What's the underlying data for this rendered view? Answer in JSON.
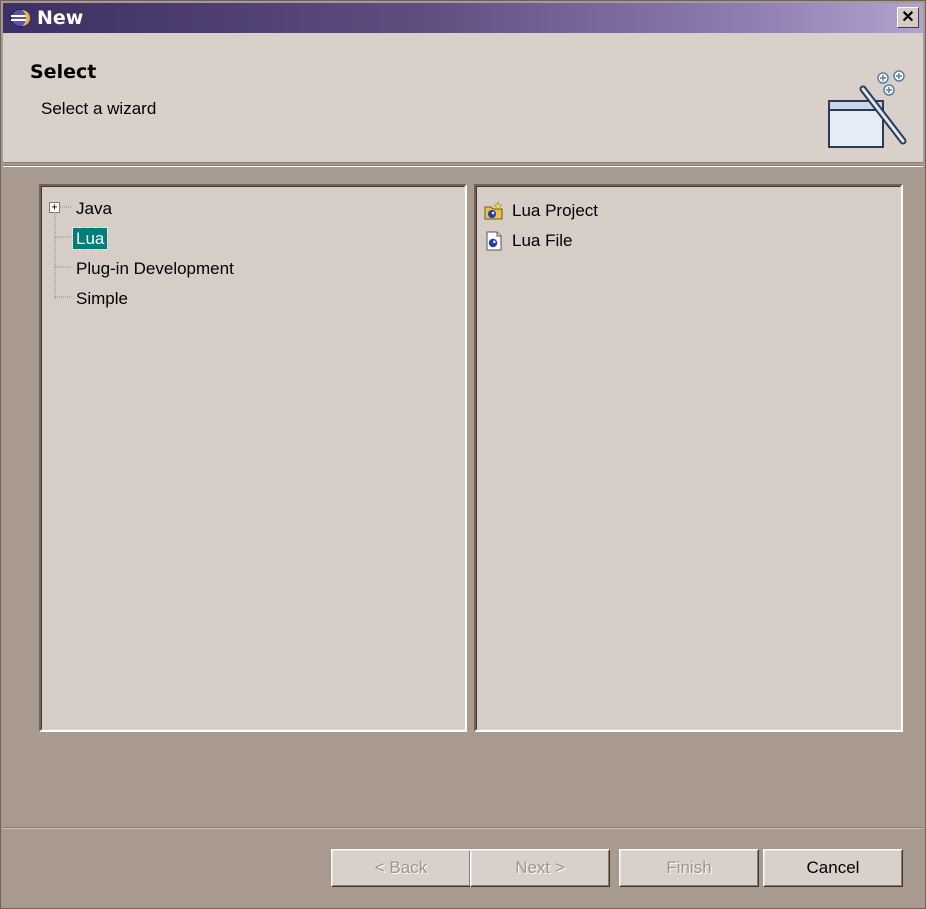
{
  "window": {
    "title": "New",
    "close_glyph": "✕"
  },
  "header": {
    "title": "Select",
    "subtitle": "Select a wizard"
  },
  "tree": {
    "items": [
      {
        "label": "Java",
        "expandable": true,
        "selected": false
      },
      {
        "label": "Lua",
        "expandable": false,
        "selected": true
      },
      {
        "label": "Plug-in Development",
        "expandable": false,
        "selected": false
      },
      {
        "label": "Simple",
        "expandable": false,
        "selected": false
      }
    ],
    "expander_glyph": "+"
  },
  "wizards": {
    "items": [
      {
        "label": "Lua Project",
        "icon": "lua-project-icon"
      },
      {
        "label": "Lua File",
        "icon": "lua-file-icon"
      }
    ]
  },
  "buttons": {
    "back": {
      "label": "< Back",
      "enabled": false
    },
    "next": {
      "label": "Next >",
      "enabled": false
    },
    "finish": {
      "label": "Finish",
      "enabled": false
    },
    "cancel": {
      "label": "Cancel",
      "enabled": true
    }
  },
  "colors": {
    "selection": "#007d7d",
    "dialog_bg": "#a89a8f",
    "panel_bg": "#d6cdc6"
  }
}
